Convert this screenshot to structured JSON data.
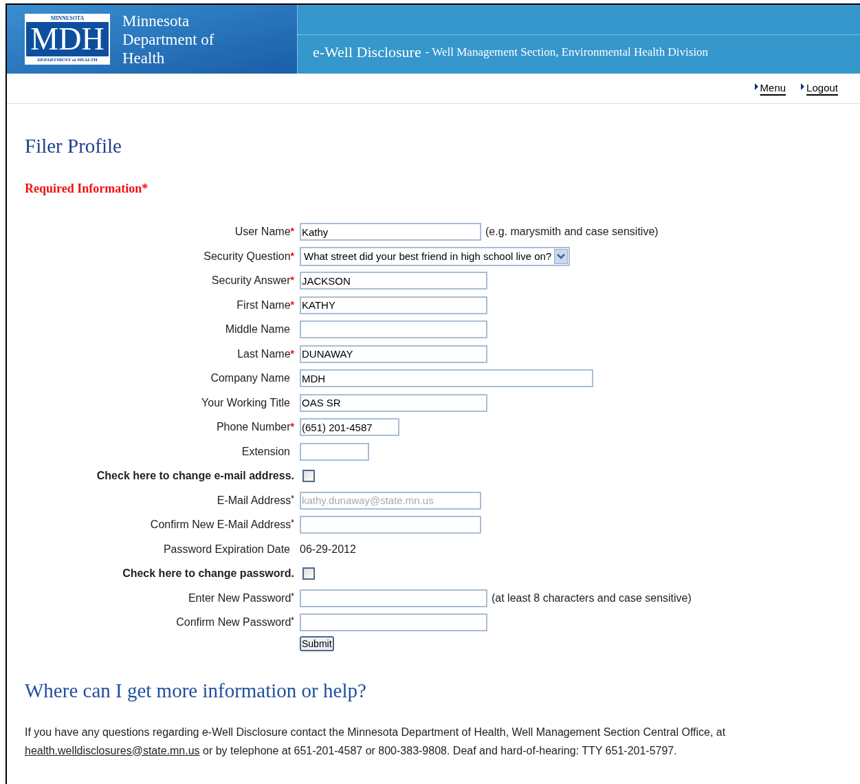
{
  "header": {
    "logo_top": "MINNESOTA",
    "logo_main": "MDH",
    "logo_bottom": "DEPARTMENT of HEALTH",
    "agency": [
      "Minnesota",
      "Department of",
      "Health"
    ],
    "app_title": "e-Well Disclosure",
    "app_subtitle": "- Well Management Section, Environmental Health Division"
  },
  "nav": [
    {
      "label": "Menu"
    },
    {
      "label": "Logout"
    }
  ],
  "page_title": "Filer Profile",
  "required_note": "Required Information*",
  "form": [
    {
      "kind": "text",
      "label": "User Name",
      "mark": "*",
      "required": true,
      "value": "Kathy",
      "hint": "(e.g. marysmith and case sensitive)"
    },
    {
      "kind": "select",
      "label": "Security Question",
      "mark": "*",
      "required": true,
      "value": "What street did your best friend in high school live on?"
    },
    {
      "kind": "text",
      "label": "Security Answer",
      "mark": "*",
      "required": true,
      "value": "JACKSON"
    },
    {
      "kind": "text",
      "label": "First Name",
      "mark": "*",
      "required": true,
      "value": "KATHY"
    },
    {
      "kind": "text",
      "label": "Middle Name"
    },
    {
      "kind": "text",
      "label": "Last Name",
      "mark": "*",
      "required": true,
      "value": "DUNAWAY"
    },
    {
      "kind": "text",
      "label": "Company Name",
      "value": "MDH"
    },
    {
      "kind": "text",
      "label": "Your Working Title",
      "value": "OAS SR"
    },
    {
      "kind": "text",
      "label": "Phone Number",
      "mark": "*",
      "required": true,
      "value": "(651) 201-4587"
    },
    {
      "kind": "text",
      "label": "Extension"
    },
    {
      "kind": "checkbox",
      "label": "Check here to change e-mail address.",
      "checked": false
    },
    {
      "kind": "text",
      "label": "E-Mail Address",
      "mark": "*",
      "required": false,
      "value": "kathy.dunaway@state.mn.us",
      "disabled": true
    },
    {
      "kind": "text",
      "label": "Confirm New E-Mail Address",
      "mark": "*",
      "required": false
    },
    {
      "kind": "static",
      "label": "Password Expiration Date",
      "value": "06-29-2012"
    },
    {
      "kind": "checkbox",
      "label": "Check here to change password.",
      "checked": false
    },
    {
      "kind": "text",
      "label": "Enter New Password",
      "mark": "*",
      "required": false,
      "hint": "(at least 8 characters and case sensitive)"
    },
    {
      "kind": "text",
      "label": "Confirm New Password",
      "mark": "*",
      "required": false
    }
  ],
  "submit": "Submit",
  "help_title": "Where can I get more information or help?",
  "help_text": [
    "If you have any questions regarding e-Well Disclosure contact the Minnesota Department of Health, Well Management Section Central Office, at ",
    "health.welldisclosures@state.mn.us",
    " or by telephone at 651-201-4587 or 800-383-9808. Deaf and hard-of-hearing: TTY 651-201-5797."
  ]
}
